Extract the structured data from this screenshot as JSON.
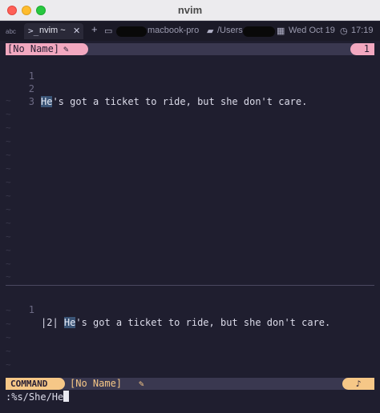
{
  "window": {
    "title": "nvim"
  },
  "tabbar": {
    "input_indicator": "abc",
    "tab_label": "nvim ~",
    "tab_close": "✕",
    "new_tab": "+",
    "host": "macbook-pro",
    "path": "/Users",
    "date": "Wed Oct 19",
    "time": "17:19"
  },
  "top_winbar": {
    "buffer_name": "[No Name]",
    "window_number": "1"
  },
  "top_pane": {
    "lines": [
      {
        "num": "1",
        "highlight": "",
        "text": ""
      },
      {
        "num": "2",
        "highlight": "He",
        "text": "'s got a ticket to ride, but she don't care."
      },
      {
        "num": "3",
        "highlight": "",
        "text": ""
      }
    ]
  },
  "preview_pane": {
    "line_num": "1",
    "prefix": "|2| ",
    "highlight": "He",
    "text": "'s got a ticket to ride, but she don't care."
  },
  "statusline": {
    "mode": "COMMAND",
    "buffer_name": "[No Name]",
    "right_icon": "♪"
  },
  "cmdline": {
    "text": ":%s/She/He"
  },
  "colors": {
    "accent_pink": "#f2a8c0",
    "accent_yellow": "#f6c787",
    "background": "#1f1e2f",
    "highlight": "#3b5577"
  }
}
